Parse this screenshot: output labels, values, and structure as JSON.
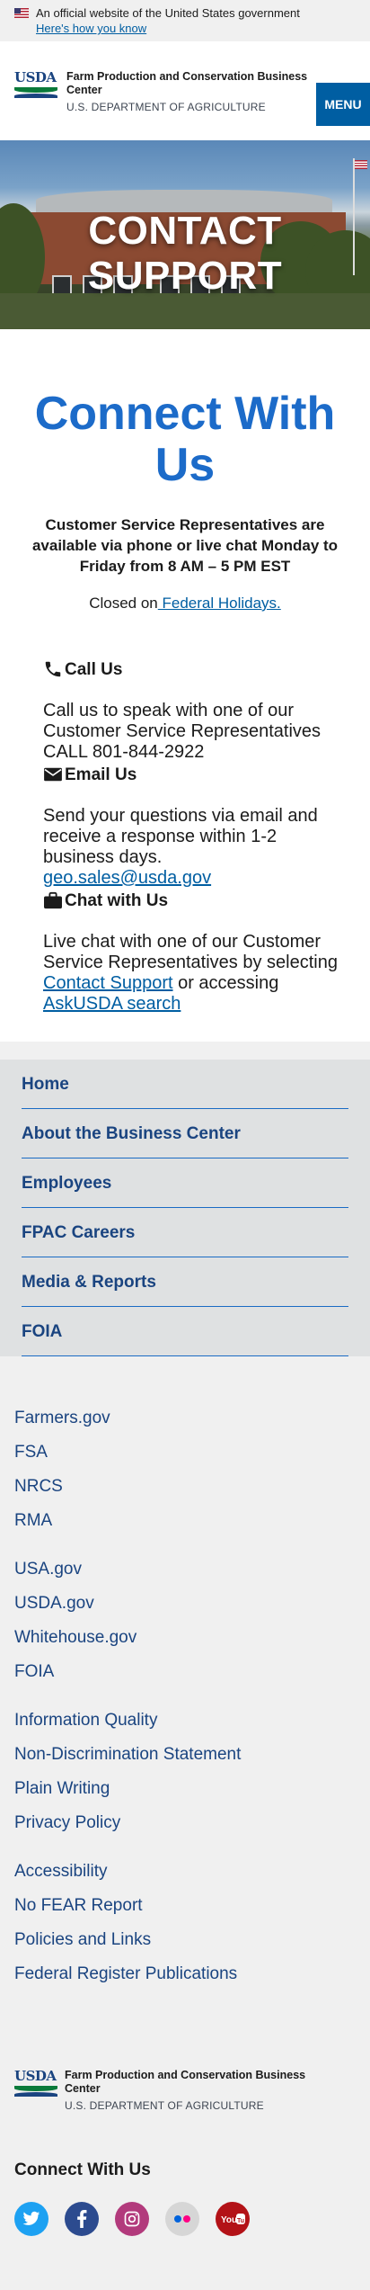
{
  "gov_banner": {
    "text": "An official website of the United States government",
    "link": "Here's how you know"
  },
  "header": {
    "title": "Farm Production and Conservation Business Center",
    "subtitle": "U.S. DEPARTMENT OF AGRICULTURE",
    "logo_text": "USDA",
    "menu_label": "MENU"
  },
  "hero": {
    "title": "CONTACT SUPPORT"
  },
  "main": {
    "heading": "Connect With Us",
    "cs_text": "Customer Service Representatives are available via phone or live chat Monday to Friday from 8 AM – 5 PM EST",
    "closed_prefix": "Closed on",
    "closed_link": " Federal Holidays.",
    "call": {
      "title": "Call Us",
      "body": "Call us to speak with one of our Customer Service Representatives CALL 801-844-2922",
      "icon": "phone-icon"
    },
    "email": {
      "title": "Email Us",
      "body": "Send your questions via email and receive a response within 1-2 business days.",
      "link": "geo.sales@usda.gov",
      "icon": "envelope-icon"
    },
    "chat": {
      "title": "Chat with Us",
      "body_before": "Live chat with one of our Customer Service Representatives by selecting ",
      "link1": "Contact Support",
      "middle": " or accessing ",
      "link2": "AskUSDA search",
      "icon": "briefcase-icon"
    }
  },
  "footer_nav": [
    "Home",
    "About the Business Center",
    "Employees",
    "FPAC Careers",
    "Media & Reports",
    "FOIA"
  ],
  "link_groups": [
    [
      "Farmers.gov",
      "FSA",
      "NRCS",
      "RMA"
    ],
    [
      "USA.gov",
      "USDA.gov",
      "Whitehouse.gov",
      "FOIA"
    ],
    [
      "Information Quality",
      "Non-Discrimination Statement",
      "Plain Writing",
      "Privacy Policy"
    ],
    [
      "Accessibility",
      "No FEAR Report",
      "Policies and Links",
      "Federal Register Publications"
    ]
  ],
  "footer": {
    "title": "Farm Production and Conservation Business Center",
    "subtitle": "U.S. DEPARTMENT OF AGRICULTURE",
    "social_title": "Connect With Us",
    "social": [
      {
        "name": "twitter-icon",
        "color": "#1da1f2",
        "glyph": "t"
      },
      {
        "name": "facebook-icon",
        "color": "#2c4b8f",
        "glyph": "f"
      },
      {
        "name": "instagram-icon",
        "color": "#b23a7c",
        "glyph": "◎"
      },
      {
        "name": "flickr-icon",
        "color": "#d6d6d6",
        "glyph": "••"
      },
      {
        "name": "youtube-icon",
        "color": "#b31217",
        "glyph": "You"
      }
    ]
  },
  "colors": {
    "accent": "#005ea2",
    "heading_blue": "#1c6bc9",
    "nav_text": "#1a4480"
  }
}
